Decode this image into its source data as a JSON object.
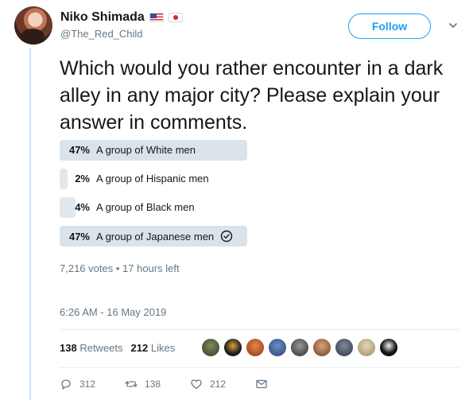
{
  "user": {
    "name": "Niko Shimada",
    "handle": "@The_Red_Child",
    "flags": [
      "us-flag-icon",
      "japan-flag-icon"
    ]
  },
  "follow_label": "Follow",
  "tweet_text": "Which would you rather encounter in a dark alley in any major city? Please explain your answer in comments.",
  "poll": {
    "options": [
      {
        "percent": "47%",
        "label": "A group of White men",
        "fraction": 0.47,
        "winner": true
      },
      {
        "percent": "2%",
        "label": "A group of Hispanic men",
        "fraction": 0.02,
        "winner": false
      },
      {
        "percent": "4%",
        "label": "A group of Black men",
        "fraction": 0.04,
        "winner": false
      },
      {
        "percent": "47%",
        "label": "A group of Japanese men",
        "fraction": 0.47,
        "winner": true,
        "voted": true
      }
    ],
    "votes": "7,216 votes",
    "time_left": "17 hours left"
  },
  "timestamp": "6:26 AM - 16 May 2019",
  "stats": {
    "retweets_count": "138",
    "retweets_label": "Retweets",
    "likes_count": "212",
    "likes_label": "Likes"
  },
  "actions": {
    "replies": "312",
    "retweets": "138",
    "likes": "212"
  },
  "colors": {
    "accent": "#1da1f2",
    "muted": "#657786",
    "poll_bar": "#e1e8ed"
  }
}
